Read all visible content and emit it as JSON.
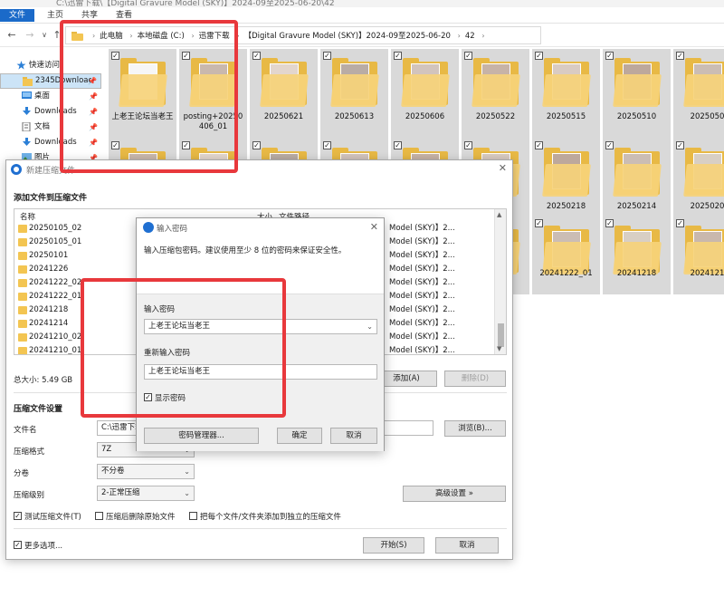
{
  "explorer": {
    "title_text": "C:\\迅雷下载\\【Digital Gravure Model (SKY)】2024-09至2025-06-20\\42",
    "ribbon_tabs": [
      "文件",
      "主页",
      "共享",
      "查看"
    ],
    "nav": {
      "back": "←",
      "forward": "→",
      "recent": "∨",
      "up": "↑"
    },
    "breadcrumbs": [
      "此电脑",
      "本地磁盘 (C:)",
      "迅雷下载",
      "【Digital Gravure Model (SKY)】2024-09至2025-06-20",
      "42"
    ],
    "sidebar": [
      {
        "label": "快速访问",
        "icon": "star-icon",
        "pinned": false
      },
      {
        "label": "2345Downloac",
        "icon": "folder-icon",
        "pinned": true
      },
      {
        "label": "桌面",
        "icon": "desktop-icon",
        "pinned": true
      },
      {
        "label": "Downloads",
        "icon": "download-icon",
        "pinned": true
      },
      {
        "label": "文档",
        "icon": "document-icon",
        "pinned": true
      },
      {
        "label": "Downloads",
        "icon": "download-icon",
        "pinned": true
      },
      {
        "label": "图片",
        "icon": "picture-icon",
        "pinned": true
      }
    ],
    "folders_row1": [
      "上老王论坛当老王",
      "posting+20250406_01",
      "20250621",
      "20250613",
      "20250606",
      "20250522",
      "20250515",
      "20250510",
      "2025050"
    ],
    "folders_row2": [
      "",
      "",
      "",
      "",
      "",
      "01",
      "20250218",
      "20250214",
      "2025020"
    ],
    "folders_row3": [
      "",
      "",
      "",
      "",
      "",
      "02",
      "20241222_01",
      "20241218",
      "2024121"
    ]
  },
  "compress": {
    "title": "新建压缩文件",
    "section_add": "添加文件到压缩文件",
    "columns": {
      "name": "名称",
      "size": "大小",
      "path": "文件路径"
    },
    "files": [
      {
        "name": "20250105_02",
        "path": "Model (SKY)】2..."
      },
      {
        "name": "20250105_01",
        "path": "Model (SKY)】2..."
      },
      {
        "name": "20250101",
        "path": "Model (SKY)】2..."
      },
      {
        "name": "20241226",
        "path": "Model (SKY)】2..."
      },
      {
        "name": "20241222_02",
        "path": "Model (SKY)】2..."
      },
      {
        "name": "20241222_01",
        "path": "Model (SKY)】2..."
      },
      {
        "name": "20241218",
        "path": "Model (SKY)】2..."
      },
      {
        "name": "20241214",
        "path": "Model (SKY)】2..."
      },
      {
        "name": "20241210_02",
        "path": "Model (SKY)】2..."
      },
      {
        "name": "20241210_01",
        "path": "Model (SKY)】2..."
      }
    ],
    "total_size": "总大小: 5.49 GB",
    "add_button": "添加(A)",
    "delete_button": "删除(D)",
    "section_settings": "压缩文件设置",
    "filename_label": "文件名",
    "filename_value": "C:\\迅雷下载",
    "browse_button": "浏览(B)...",
    "format_label": "压缩格式",
    "format_value": "7Z",
    "split_label": "分卷",
    "split_value": "不分卷",
    "level_label": "压缩级别",
    "level_value": "2-正常压缩",
    "advanced_button": "高级设置 »",
    "test_label": "测试压缩文件(T)",
    "delete_after_label": "压缩后删除原始文件",
    "separate_label": "把每个文件/文件夹添加到独立的压缩文件",
    "more_label": "更多选项...",
    "start_button": "开始(S)",
    "cancel_button": "取消"
  },
  "password": {
    "title": "输入密码",
    "description": "输入压缩包密码。建议使用至少 8 位的密码来保证安全性。",
    "enter_label": "输入密码",
    "enter_value": "上老王论坛当老王",
    "reenter_label": "重新输入密码",
    "reenter_value": "上老王论坛当老王",
    "show_label": "显示密码",
    "manager_button": "密码管理器...",
    "ok_button": "确定",
    "cancel_button": "取消"
  },
  "colors": {
    "accent": "#1b6ac9",
    "folder": "#e8b945",
    "annotation": "#e8383c",
    "selection": "#cce4f7"
  }
}
